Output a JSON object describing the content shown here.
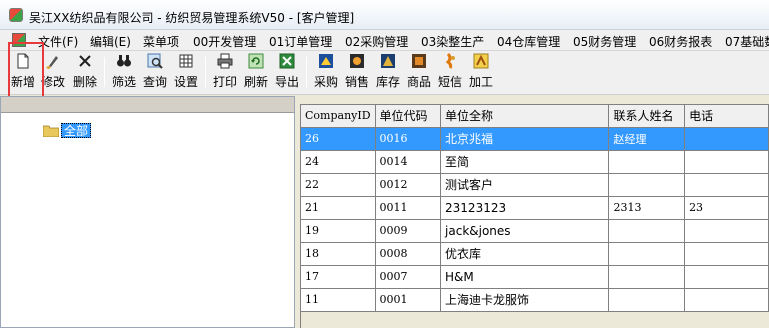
{
  "window": {
    "title": "吴江XX纺织品有限公司 - 纺织贸易管理系统V50 - [客户管理]"
  },
  "menu": [
    {
      "label": "文件(F)"
    },
    {
      "label": "编辑(E)"
    },
    {
      "label": "菜单项"
    },
    {
      "label": "00开发管理"
    },
    {
      "label": "01订单管理"
    },
    {
      "label": "02采购管理"
    },
    {
      "label": "03染整生产"
    },
    {
      "label": "04仓库管理"
    },
    {
      "label": "05财务管理"
    },
    {
      "label": "06财务报表"
    },
    {
      "label": "07基础数"
    }
  ],
  "toolbar": {
    "new": "新增",
    "edit": "修改",
    "delete": "删除",
    "filter": "筛选",
    "query": "查询",
    "settings": "设置",
    "print": "打印",
    "refresh": "刷新",
    "export": "导出",
    "purchase": "采购",
    "sales": "销售",
    "stock": "库存",
    "product": "商品",
    "sms": "短信",
    "process": "加工"
  },
  "tree": {
    "root_label": "全部"
  },
  "grid": {
    "columns": [
      "CompanyID",
      "单位代码",
      "单位全称",
      "联系人姓名",
      "电话"
    ],
    "rows": [
      {
        "id": "26",
        "code": "0016",
        "name": "北京兆福",
        "contact": "赵经理",
        "phone": "",
        "selected": true
      },
      {
        "id": "24",
        "code": "0014",
        "name": "至简",
        "contact": "",
        "phone": ""
      },
      {
        "id": "22",
        "code": "0012",
        "name": "测试客户",
        "contact": "",
        "phone": ""
      },
      {
        "id": "21",
        "code": "0011",
        "name": "23123123",
        "contact": "2313",
        "phone": "23"
      },
      {
        "id": "19",
        "code": "0009",
        "name": "jack&jones",
        "contact": "",
        "phone": ""
      },
      {
        "id": "18",
        "code": "0008",
        "name": "优衣库",
        "contact": "",
        "phone": ""
      },
      {
        "id": "17",
        "code": "0007",
        "name": "H&M",
        "contact": "",
        "phone": ""
      },
      {
        "id": "11",
        "code": "0001",
        "name": "上海迪卡龙服饰",
        "contact": "",
        "phone": ""
      }
    ]
  },
  "colors": {
    "selection": "#3399ff",
    "highlight_box": "#e83a3a"
  }
}
